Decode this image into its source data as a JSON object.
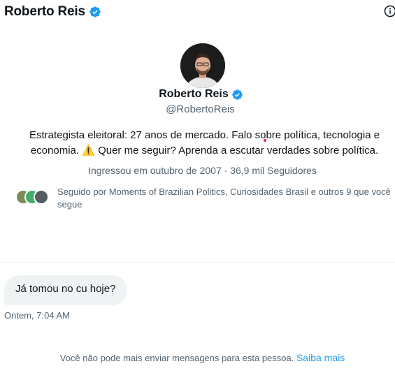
{
  "header": {
    "name": "Roberto Reis",
    "verified_icon": "verified-badge-icon",
    "info_icon": "info-icon"
  },
  "profile": {
    "name": "Roberto Reis",
    "handle": "@RobertoReis",
    "bio_line1": "Estrategista eleitoral: 27 anos de mercado. Falo sobre política, tecnologia e",
    "bio_line2_pre": "economia. ",
    "bio_warning": "⚠️",
    "bio_line2_post": " Quer me seguir? Aprenda a escutar verdades sobre política.",
    "joined": "Ingressou em outubro de 2007 · 36,9 mil Seguidores",
    "followed_by": "Seguido por Moments of Brazilian Politics, Curiosidades Brasil e outros 9 que você segue"
  },
  "conversation": {
    "messages": [
      {
        "text": "Já tomou no cu hoje?",
        "time": "Ontem, 7:04 AM"
      }
    ]
  },
  "footer": {
    "notice": "Você não pode mais enviar mensagens para esta pessoa. ",
    "link": "Saiba mais"
  },
  "colors": {
    "accent": "#1d9bf0",
    "secondary_text": "#536471",
    "bubble_bg": "#eff3f4"
  }
}
